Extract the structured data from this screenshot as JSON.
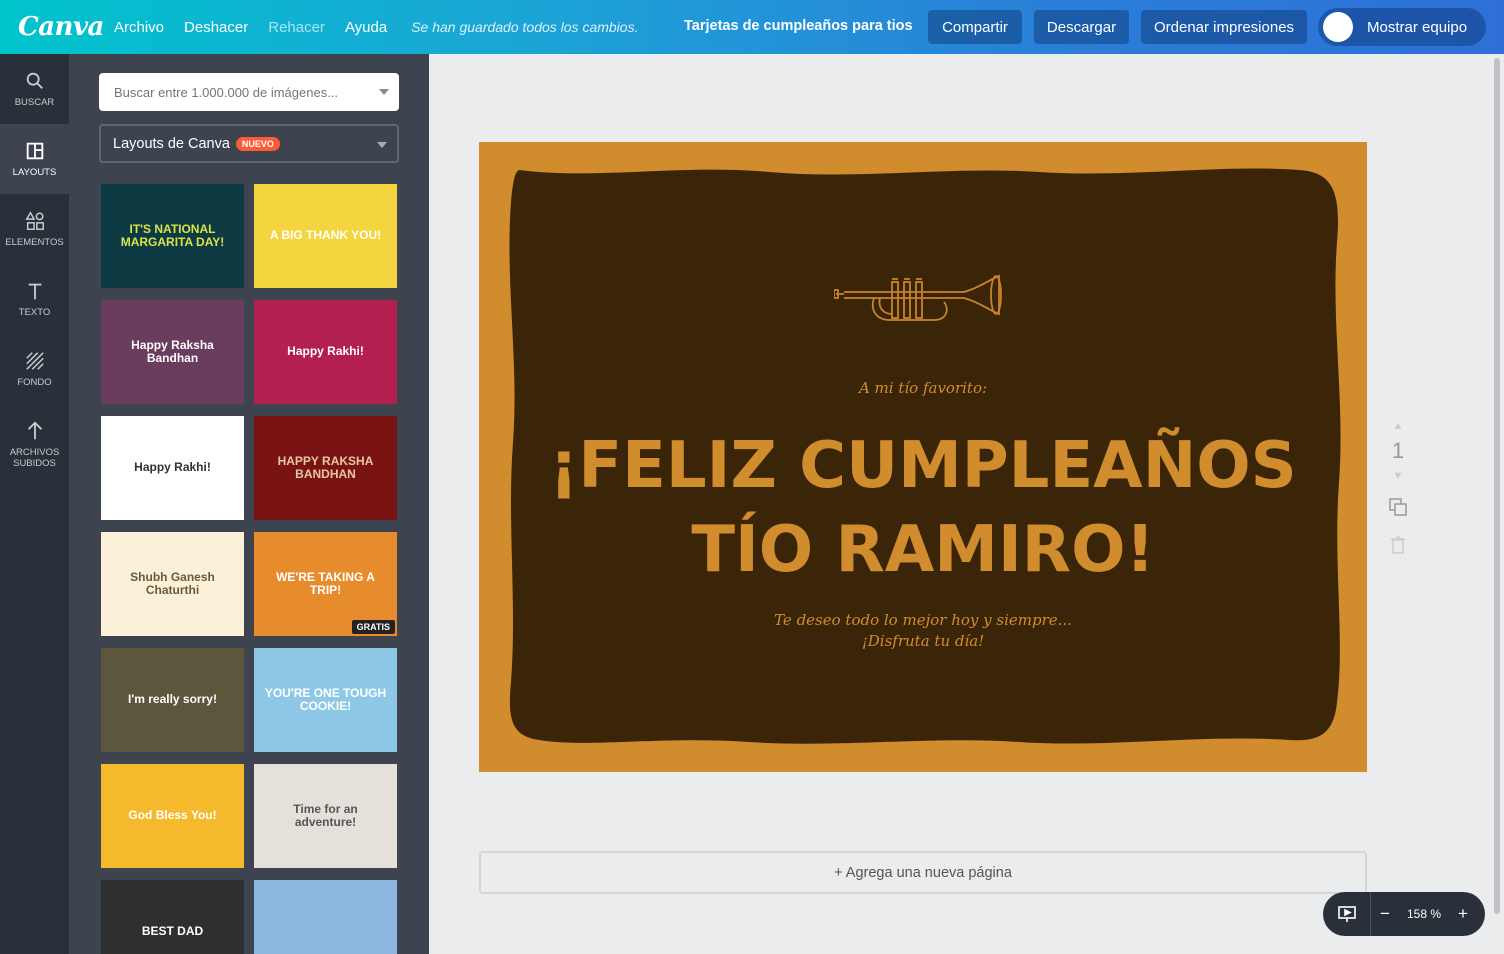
{
  "topbar": {
    "logo": "Canva",
    "menu": [
      "Archivo",
      "Deshacer",
      "Rehacer",
      "Ayuda"
    ],
    "saved_status": "Se han guardado todos los cambios.",
    "doc_title": "Tarjetas de cumpleaños para tios",
    "share_label": "Compartir",
    "download_label": "Descargar",
    "print_label": "Ordenar impresiones",
    "team_label": "Mostrar equipo"
  },
  "rail": {
    "items": [
      {
        "label": "BUSCAR",
        "icon": "search-icon"
      },
      {
        "label": "LAYOUTS",
        "icon": "layout-icon"
      },
      {
        "label": "ELEMENTOS",
        "icon": "shapes-icon"
      },
      {
        "label": "TEXTO",
        "icon": "text-icon"
      },
      {
        "label": "FONDO",
        "icon": "background-icon"
      },
      {
        "label": "ARCHIVOS SUBIDOS",
        "icon": "upload-icon"
      }
    ]
  },
  "panel": {
    "search_placeholder": "Buscar entre 1.000.000 de imágenes...",
    "dropdown_label": "Layouts de Canva",
    "dropdown_badge": "NUEVO",
    "thumbnails": [
      {
        "text": "IT'S NATIONAL MARGARITA DAY!",
        "bg": "#0e3b43",
        "fg": "#d9e34a"
      },
      {
        "text": "A BIG THANK YOU!",
        "bg": "#f5d53f",
        "fg": "#ffffff"
      },
      {
        "text": "Happy Raksha Bandhan",
        "bg": "#6a3c5e",
        "fg": "#ffffff"
      },
      {
        "text": "Happy Rakhi!",
        "bg": "#b3204f",
        "fg": "#ffffff"
      },
      {
        "text": "Happy Rakhi!",
        "bg": "#ffffff",
        "fg": "#333333"
      },
      {
        "text": "HAPPY RAKSHA BANDHAN",
        "bg": "#7a1414",
        "fg": "#e8c8a0"
      },
      {
        "text": "Shubh Ganesh Chaturthi",
        "bg": "#fbf0d8",
        "fg": "#6b5a3c"
      },
      {
        "text": "WE'RE TAKING A TRIP!",
        "bg": "#e78c2d",
        "fg": "#ffffff",
        "badge": "GRATIS"
      },
      {
        "text": "I'm really sorry!",
        "bg": "#5c573c",
        "fg": "#ffffff"
      },
      {
        "text": "YOU'RE ONE TOUGH COOKIE!",
        "bg": "#8fc8e6",
        "fg": "#ffffff"
      },
      {
        "text": "God Bless You!",
        "bg": "#f4b92c",
        "fg": "#ffffff"
      },
      {
        "text": "Time for an adventure!",
        "bg": "#e5e1da",
        "fg": "#555555"
      },
      {
        "text": "BEST DAD",
        "bg": "#2f2f2f",
        "fg": "#ffffff"
      },
      {
        "text": "",
        "bg": "#8cb7e0",
        "fg": "#ffffff"
      }
    ]
  },
  "card": {
    "subtitle": "A mi tío favorito:",
    "headline_line1": "¡FELIZ CUMPLEAÑOS",
    "headline_line2": "TÍO RAMIRO!",
    "wish_line1": "Te deseo todo lo mejor hoy y siempre...",
    "wish_line2": "¡Disfruta tu día!",
    "colors": {
      "frame": "#d18c2d",
      "inner": "#3b2508",
      "text": "#d18c2d"
    }
  },
  "page_number": "1",
  "add_page_label": "+ Agrega una nueva página",
  "zoom_level": "158 %"
}
